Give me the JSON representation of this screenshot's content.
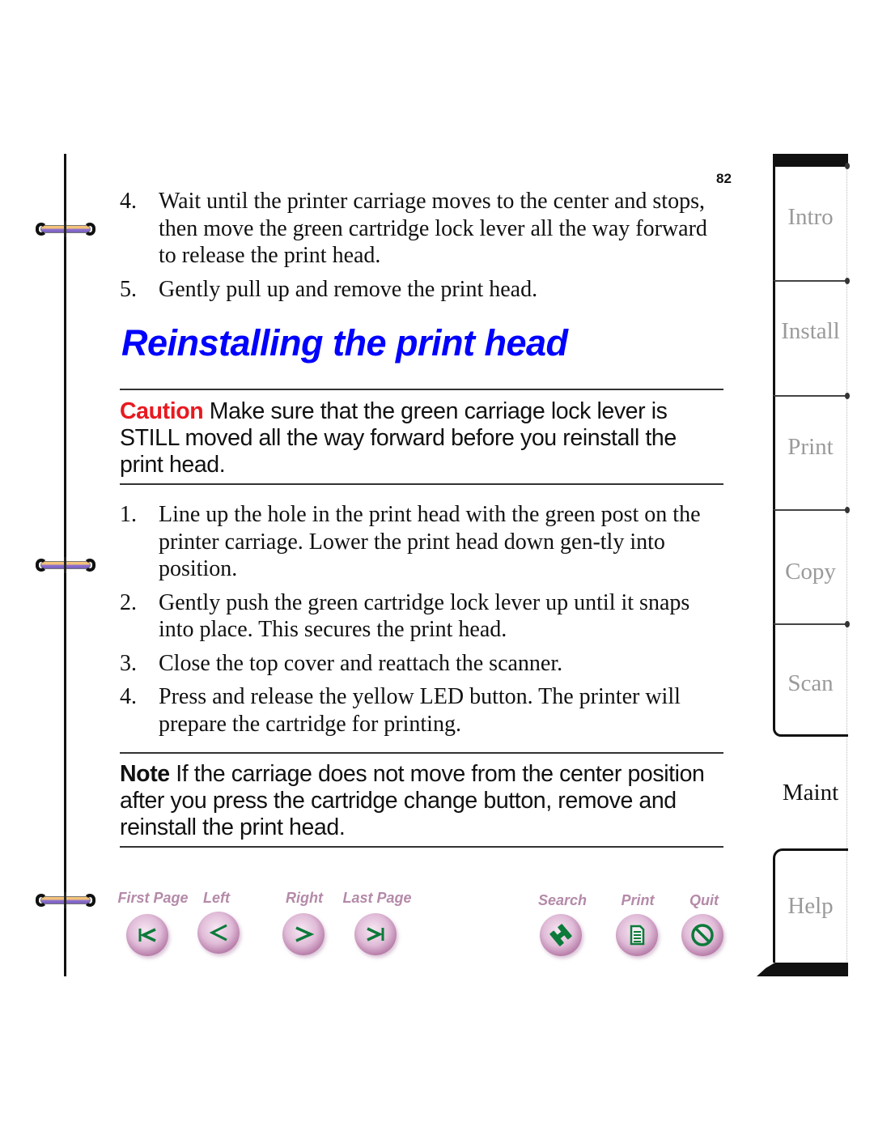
{
  "page": {
    "number": "82"
  },
  "steps_before": [
    {
      "num": "4.",
      "text": "Wait until the printer carriage moves to the center and stops, then move the green cartridge lock lever all the way forward to release the print head."
    },
    {
      "num": "5.",
      "text": "Gently pull up and remove the print head."
    }
  ],
  "section_title": "Reinstalling the print head",
  "caution": {
    "label": "Caution",
    "text": " Make sure that the green carriage lock lever is STILL moved all the way forward before you reinstall the print head.",
    "label_color": "#e8191f"
  },
  "steps_after": [
    {
      "num": "1.",
      "text": "Line up the hole in the print head with the green post on the printer carriage. Lower the print head down gen-tly into position."
    },
    {
      "num": "2.",
      "text": "Gently push the green cartridge lock lever  up until it snaps into place. This secures the print head."
    },
    {
      "num": "3.",
      "text": "Close the top cover and reattach the scanner."
    },
    {
      "num": "4.",
      "text": "Press and release the yellow LED button. The printer will prepare the cartridge for printing."
    }
  ],
  "note": {
    "label": "Note",
    "text": " If the carriage does not move from the center position after you press the cartridge change button, remove and reinstall the print head."
  },
  "nav_buttons": [
    {
      "label": "First Page",
      "icon": "first-page-icon"
    },
    {
      "label": "Left",
      "icon": "left-arrow-icon"
    },
    {
      "label": "Right",
      "icon": "right-arrow-icon"
    },
    {
      "label": "Last Page",
      "icon": "last-page-icon"
    },
    {
      "label": "Search",
      "icon": "binoculars-icon"
    },
    {
      "label": "Print",
      "icon": "document-icon"
    },
    {
      "label": "Quit",
      "icon": "no-entry-icon"
    }
  ],
  "tabs": [
    {
      "label": "Intro",
      "active": false
    },
    {
      "label": "Install",
      "active": false
    },
    {
      "label": "Print",
      "active": false
    },
    {
      "label": "Copy",
      "active": false
    },
    {
      "label": "Scan",
      "active": false
    },
    {
      "label": "Maint",
      "active": true
    },
    {
      "label": "Help",
      "active": false
    }
  ],
  "colors": {
    "title": "#0000ff",
    "nav_label": "#b48aa8",
    "icon_green": "#0c7a3a",
    "tab_inactive": "#9a9a9a"
  }
}
